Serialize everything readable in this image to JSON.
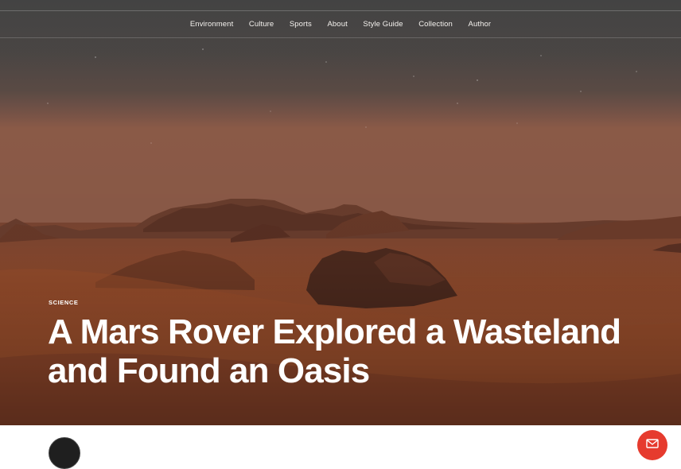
{
  "nav": {
    "items": [
      {
        "label": "Environment"
      },
      {
        "label": "Culture"
      },
      {
        "label": "Sports"
      },
      {
        "label": "About"
      },
      {
        "label": "Style Guide"
      },
      {
        "label": "Collection"
      },
      {
        "label": "Author"
      }
    ]
  },
  "hero": {
    "category": "SCIENCE",
    "title_line1": "A Mars Rover Explored a Wasteland",
    "title_line2": "and Found an Oasis"
  },
  "colors": {
    "accent": "#e63b2e",
    "sky_top": "#424242",
    "sand": "#9a4a2a"
  },
  "icons": {
    "subscribe": "mail-icon",
    "author": "avatar"
  }
}
